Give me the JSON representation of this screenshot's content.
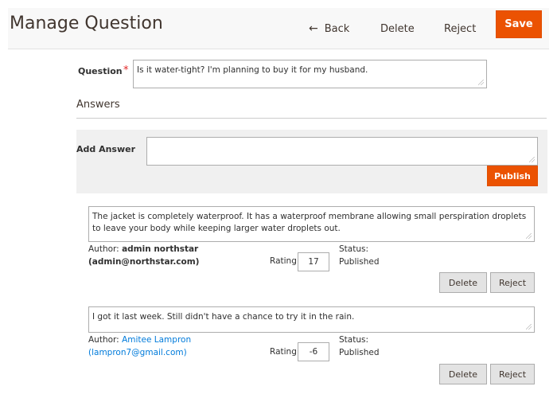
{
  "header": {
    "title": "Manage Question",
    "back_label": "Back",
    "delete_label": "Delete",
    "reject_label": "Reject",
    "save_label": "Save"
  },
  "question": {
    "label": "Question",
    "required_mark": "*",
    "value": "Is it water-tight? I'm planning to buy it for my husband."
  },
  "answers_section": {
    "title": "Answers",
    "add_answer_label": "Add Answer",
    "add_answer_value": "",
    "publish_label": "Publish"
  },
  "answers": [
    {
      "text": "The jacket is completely waterproof. It has a waterproof membrane allowing small perspiration droplets to leave your body while keeping larger water droplets out.",
      "author_prefix": "Author:",
      "author_name": "admin northstar",
      "author_email": "(admin@northstar.com)",
      "rating_label": "Rating",
      "rating": "17",
      "status_label": "Status:",
      "status": "Published",
      "delete_label": "Delete",
      "reject_label": "Reject"
    },
    {
      "text": "I got it last week. Still didn't have a chance to try it in the rain.",
      "author_prefix": "Author:",
      "author_name": "Amitee Lampron",
      "author_email": "(lampron7@gmail.com)",
      "rating_label": "Rating",
      "rating": "-6",
      "status_label": "Status:",
      "status": "Published",
      "delete_label": "Delete",
      "reject_label": "Reject"
    }
  ],
  "colors": {
    "accent": "#eb5202",
    "link": "#007bdb",
    "required": "#e22626"
  }
}
